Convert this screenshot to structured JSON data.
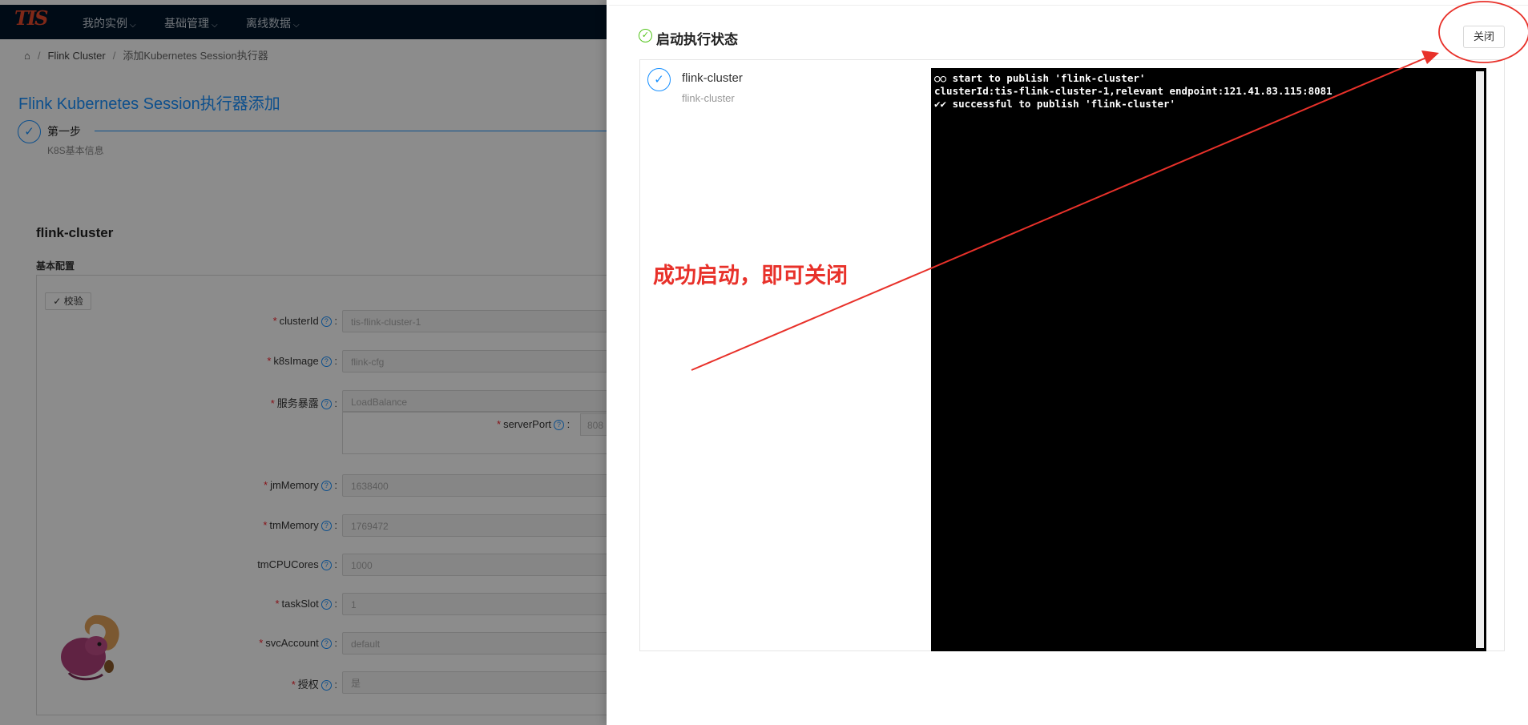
{
  "app": {
    "logo_text": "TIS",
    "nav": [
      {
        "label": "我的实例"
      },
      {
        "label": "基础管理"
      },
      {
        "label": "离线数据"
      }
    ],
    "breadcrumb": [
      "Flink Cluster",
      "添加Kubernetes Session执行器"
    ],
    "page_title": "Flink Kubernetes Session执行器添加",
    "step": {
      "title": "第一步",
      "desc": "K8S基本信息"
    },
    "section_title": "flink-cluster",
    "basic_config_label": "基本配置",
    "verify_label": "校验",
    "fields": [
      {
        "label": "clusterId",
        "required": true,
        "value": "tis-flink-cluster-1"
      },
      {
        "label": "k8sImage",
        "required": true,
        "value": "flink-cfg"
      },
      {
        "label": "服务暴露",
        "required": true,
        "value": "LoadBalance"
      },
      {
        "label": "jmMemory",
        "required": true,
        "value": "1638400"
      },
      {
        "label": "tmMemory",
        "required": true,
        "value": "1769472"
      },
      {
        "label": "tmCPUCores",
        "required": false,
        "value": "1000"
      },
      {
        "label": "taskSlot",
        "required": true,
        "value": "1"
      },
      {
        "label": "svcAccount",
        "required": true,
        "value": "default"
      },
      {
        "label": "授权",
        "required": true,
        "value": "是"
      }
    ],
    "sub_field": {
      "label": "serverPort",
      "required": true,
      "value": "808"
    }
  },
  "drawer": {
    "title": "启动执行状态",
    "close_label": "关闭",
    "item": {
      "title": "flink-cluster",
      "subtitle": "flink-cluster"
    },
    "console_lines": [
      "○○ start to publish 'flink-cluster'",
      "clusterId:tis-flink-cluster-1,relevant endpoint:121.41.83.115:8081",
      "✔✔ successful to publish 'flink-cluster'"
    ]
  },
  "annotation": {
    "text": "成功启动，即可关闭",
    "color": "#e8312a"
  },
  "colors": {
    "primary": "#1890ff",
    "success": "#52c41a",
    "required": "#f5222d",
    "nav_bg": "#001529"
  },
  "icons": [
    "home-icon",
    "check-icon",
    "question-icon",
    "check-circle-icon",
    "chevron-down-icon",
    "squirrel-logo-icon"
  ]
}
